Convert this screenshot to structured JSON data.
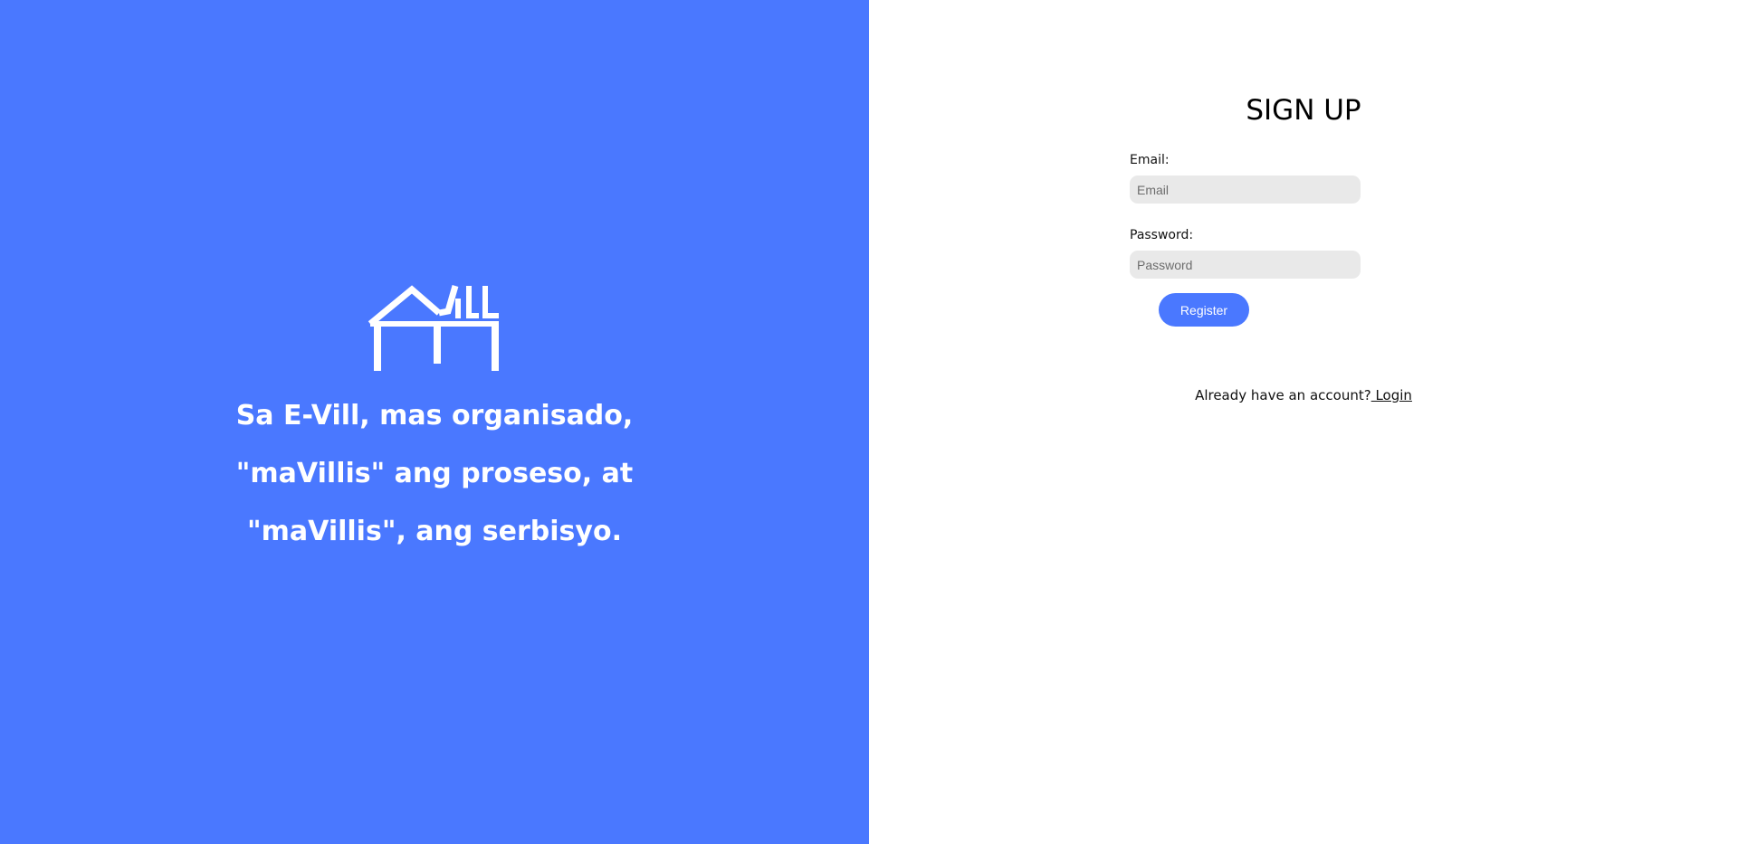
{
  "brand": {
    "logo_text": "VILL",
    "accent_color": "#4a78ff",
    "tagline_lines": [
      "Sa E-Vill, mas organisado,",
      "\"maVillis\" ang proseso, at",
      "\"maVillis\", ang serbisyo."
    ]
  },
  "form": {
    "title": "SIGN UP",
    "email_label": "Email:",
    "email_placeholder": "Email",
    "email_value": "",
    "password_label": "Password:",
    "password_placeholder": "Password",
    "password_value": "",
    "register_label": "Register"
  },
  "footer": {
    "prompt": "Already have an account?",
    "login_label": " Login"
  }
}
